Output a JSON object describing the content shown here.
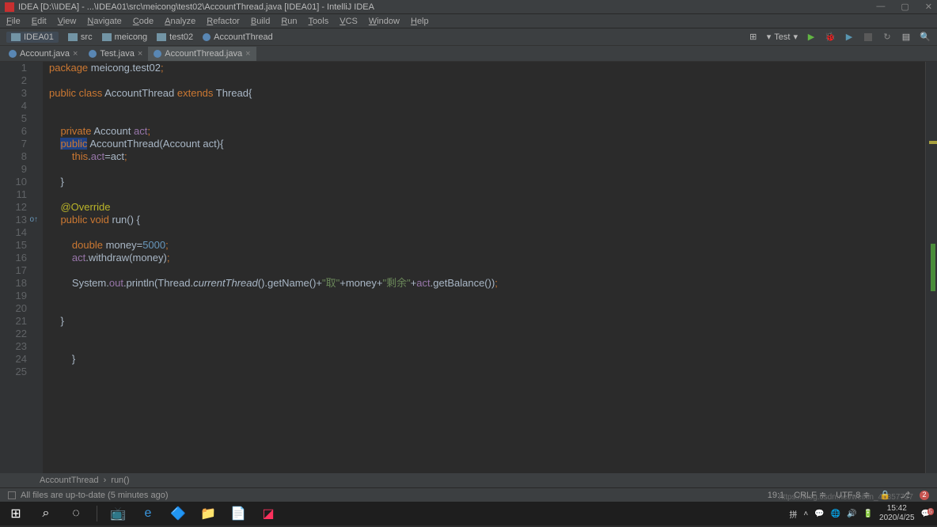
{
  "title": "IDEA [D:\\\\IDEA] - ...\\IDEA01\\src\\meicong\\test02\\AccountThread.java [IDEA01] - IntelliJ IDEA",
  "menu": [
    "File",
    "Edit",
    "View",
    "Navigate",
    "Code",
    "Analyze",
    "Refactor",
    "Build",
    "Run",
    "Tools",
    "VCS",
    "Window",
    "Help"
  ],
  "nav": {
    "project": "IDEA01",
    "crumbs": [
      "src",
      "meicong",
      "test02"
    ],
    "file": "AccountThread",
    "config": "Test"
  },
  "tabs": [
    {
      "name": "Account.java",
      "active": false
    },
    {
      "name": "Test.java",
      "active": false
    },
    {
      "name": "AccountThread.java",
      "active": true
    }
  ],
  "breadcrumb": {
    "class": "AccountThread",
    "method": "run()"
  },
  "statusMsg": "All files are up-to-date (5 minutes ago)",
  "statusRight": {
    "pos": "19:1",
    "crlf": "CRLF",
    "enc": "UTF-8",
    "lock": "🔒",
    "git": "⎇"
  },
  "code": {
    "lines": [
      {
        "n": 1,
        "html": "<span class='kw'>package</span> meicong.test02<span class='sem'>;</span>"
      },
      {
        "n": 2,
        "html": ""
      },
      {
        "n": 3,
        "html": "<span class='kw'>public class</span> AccountThread <span class='kw'>extends</span> Thread{"
      },
      {
        "n": 4,
        "html": ""
      },
      {
        "n": 5,
        "html": ""
      },
      {
        "n": 6,
        "html": "    <span class='kw'>private</span> Account <span class='fld'>act</span><span class='sem'>;</span>"
      },
      {
        "n": 7,
        "html": "    <span class='hl'><span class='kw'>public</span></span> AccountThread(Account act){"
      },
      {
        "n": 8,
        "html": "        <span class='kw'>this</span>.<span class='fld'>act</span>=act<span class='sem'>;</span>"
      },
      {
        "n": 9,
        "html": ""
      },
      {
        "n": 10,
        "html": "    }"
      },
      {
        "n": 11,
        "html": ""
      },
      {
        "n": 12,
        "html": "    <span class='ann'>@Override</span>"
      },
      {
        "n": 13,
        "html": "    <span class='kw'>public void</span> run() {",
        "ov": true
      },
      {
        "n": 14,
        "html": ""
      },
      {
        "n": 15,
        "html": "        <span class='kw'>double</span> money=<span class='num'>5000</span><span class='sem'>;</span>"
      },
      {
        "n": 16,
        "html": "        <span class='fld'>act</span>.withdraw(money)<span class='sem'>;</span>"
      },
      {
        "n": 17,
        "html": ""
      },
      {
        "n": 18,
        "html": "        System.<span class='fld'>out</span>.println(Thread.<span style='font-style:italic'>currentThread</span>().getName()+<span class='str'>\"取\"</span>+money+<span class='str'>\"剩余\"</span>+<span class='fld'>act</span>.getBalance())<span class='sem'>;</span>"
      },
      {
        "n": 19,
        "html": ""
      },
      {
        "n": 20,
        "html": ""
      },
      {
        "n": 21,
        "html": "    }"
      },
      {
        "n": 22,
        "html": ""
      },
      {
        "n": 23,
        "html": ""
      },
      {
        "n": 24,
        "html": "        }"
      },
      {
        "n": 25,
        "html": ""
      }
    ]
  },
  "clock": {
    "time": "15:42",
    "date": "2020/4/25"
  },
  "watermark": "https://blog.csdn.net/weixin_44357737"
}
